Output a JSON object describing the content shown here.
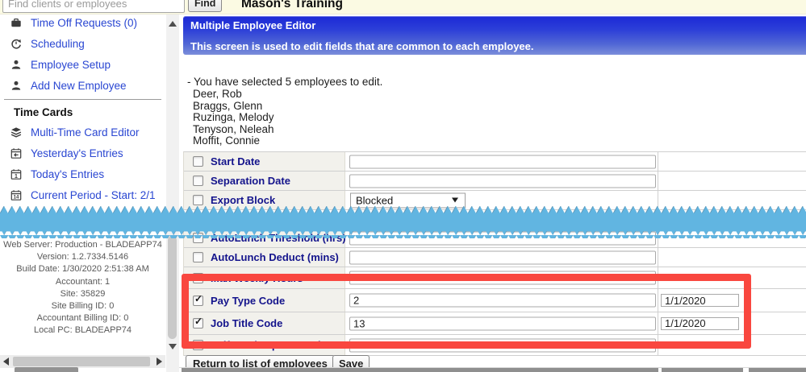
{
  "top_bar": {
    "search_placeholder": "Find clients or employees",
    "find_button": "Find",
    "title": "Mason's Training"
  },
  "sidebar": {
    "nav_top": [
      {
        "label": "Time Off Requests (0)",
        "icon": "briefcase-icon"
      },
      {
        "label": "Scheduling",
        "icon": "schedule-icon"
      },
      {
        "label": "Employee Setup",
        "icon": "person-icon"
      },
      {
        "label": "Add New Employee",
        "icon": "person-icon"
      }
    ],
    "section_header": "Time Cards",
    "nav_time_cards": [
      {
        "label": "Multi-Time Card Editor",
        "icon": "layers-icon"
      },
      {
        "label": "Yesterday's Entries",
        "icon": "calendar-back-icon"
      },
      {
        "label": "Today's Entries",
        "icon": "calendar-1-icon"
      },
      {
        "label": "Current Period - Start: 2/1",
        "icon": "calendar-14-icon"
      }
    ],
    "server_info": [
      "Web Server: Production - BLADEAPP74",
      "Version: 1.2.7334.5146",
      "Build Date: 1/30/2020 2:51:38 AM",
      "Accountant: 1",
      "Site: 35829",
      "Site Billing ID: 0",
      "Accountant Billing ID: 0",
      "Local PC: BLADEAPP74"
    ]
  },
  "main": {
    "panel_title": "Multiple Employee Editor",
    "panel_subtitle": "This screen is used to edit fields that are common to each employee.",
    "selected_text": "- You have selected 5 employees to edit.",
    "employees": [
      "Deer, Rob",
      "Braggs, Glenn",
      "Ruzinga, Melody",
      "Tenyson, Neleah",
      "Moffit, Connie"
    ],
    "form_rows_top": [
      {
        "label": "Start Date",
        "checked": false,
        "control": "input",
        "value": ""
      },
      {
        "label": "Separation Date",
        "checked": false,
        "control": "input",
        "value": ""
      },
      {
        "label": "Export Block",
        "checked": false,
        "control": "select",
        "value": "Blocked"
      }
    ],
    "form_rows_bottom": [
      {
        "label": "AutoLunch Threshold (hrs)",
        "checked": false,
        "value": "",
        "date": ""
      },
      {
        "label": "AutoLunch Deduct (mins)",
        "checked": false,
        "value": "",
        "date": ""
      },
      {
        "label": "Max Weekly Hours",
        "checked": false,
        "value": "",
        "date": ""
      },
      {
        "label": "Pay Type Code",
        "checked": true,
        "value": "2",
        "date": "1/1/2020"
      },
      {
        "label": "Job Title Code",
        "checked": true,
        "value": "13",
        "date": "1/1/2020"
      },
      {
        "label": "Self service password",
        "checked": false,
        "value": "",
        "date": ""
      }
    ],
    "buttons": {
      "return": "Return to list of employees",
      "save": "Save"
    }
  },
  "colors": {
    "panel_blue": "#1c29d6",
    "zigzag_blue": "#61b5e1",
    "highlight_red": "#f9473f",
    "label_navy": "#14148c",
    "link_blue": "#2946d2",
    "topbar_yellow": "#fbfae3"
  }
}
